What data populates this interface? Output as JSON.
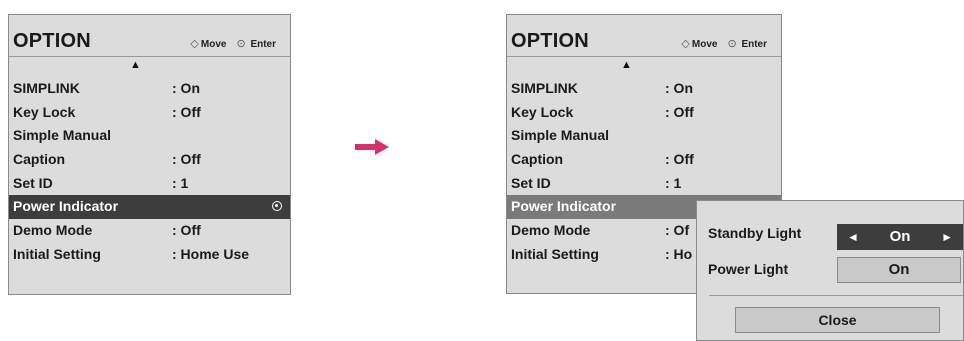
{
  "left_menu": {
    "title": "OPTION",
    "hint_move": "Move",
    "hint_enter": "Enter",
    "move_icon": "arrows-icon",
    "enter_icon": "circle-dot-icon",
    "scroll_indicator": "▲",
    "items": [
      {
        "label": "SIMPLINK",
        "value": ": On"
      },
      {
        "label": "Key Lock",
        "value": ": Off"
      },
      {
        "label": "Simple Manual",
        "value": ""
      },
      {
        "label": "Caption",
        "value": ": Off"
      },
      {
        "label": "Set ID",
        "value": ": 1"
      },
      {
        "label": "Power Indicator",
        "value": ""
      },
      {
        "label": "Demo Mode",
        "value": ": Off"
      },
      {
        "label": "Initial Setting",
        "value": ": Home Use"
      }
    ],
    "selected_index": 5
  },
  "right_menu": {
    "title": "OPTION",
    "hint_move": "Move",
    "hint_enter": "Enter",
    "scroll_indicator": "▲",
    "items": [
      {
        "label": "SIMPLINK",
        "value": ": On"
      },
      {
        "label": "Key Lock",
        "value": ": Off"
      },
      {
        "label": "Simple Manual",
        "value": ""
      },
      {
        "label": "Caption",
        "value": ": Off"
      },
      {
        "label": "Set ID",
        "value": ": 1"
      },
      {
        "label": "Power Indicator",
        "value": ""
      },
      {
        "label": "Demo Mode",
        "value": ": Of"
      },
      {
        "label": "Initial Setting",
        "value": ": Ho"
      }
    ],
    "selected_index": 5
  },
  "transition_arrow": {
    "icon": "right-arrow-icon",
    "color": "#d6336c"
  },
  "popup": {
    "standby_label": "Standby Light",
    "standby_value": "On",
    "standby_left_arrow": "◄",
    "standby_right_arrow": "►",
    "power_label": "Power Light",
    "power_value": "On",
    "close_label": "Close"
  },
  "colors": {
    "menu_bg": "#dcdcdc",
    "selected_bg": "#3d3d3d",
    "selected_bg_inactive": "#7a7a7a",
    "accent_arrow": "#d6336c"
  }
}
